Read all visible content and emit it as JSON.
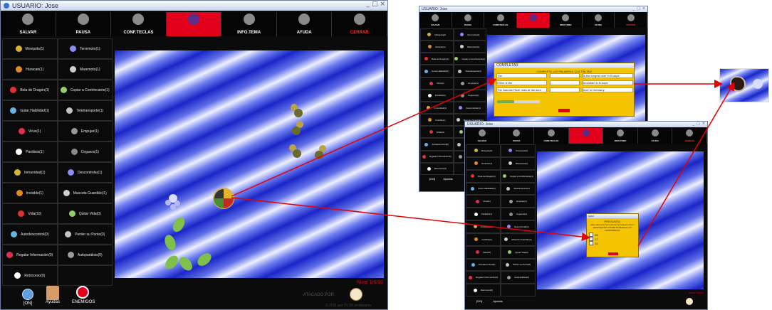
{
  "main_window": {
    "title": "USUARIO: Jose",
    "win_controls": [
      "_",
      "□",
      "×"
    ],
    "toolbar": [
      {
        "label": "SALVAR",
        "icon": "save-disc-icon",
        "red": false
      },
      {
        "label": "PAUSA",
        "icon": "pause-skull-icon",
        "red": false
      },
      {
        "label": "CONF.TECLAS",
        "icon": "keyboard-icon",
        "red": false
      },
      {
        "label": "",
        "icon": "magic-orb-icon",
        "red": true
      },
      {
        "label": "INFO.TEMA",
        "icon": "info-book-icon",
        "red": false
      },
      {
        "label": "AYUDA",
        "icon": "help-gear-icon",
        "red": false
      },
      {
        "label": "CERRAR",
        "icon": "close-door-icon",
        "red": false
      }
    ],
    "powers": [
      "Mosquita(1)",
      "Terremoto(1)",
      "Huracan(1)",
      "Maremoto(1)",
      "Bola de Dragón(1)",
      "Copiar a Contrincante(1)",
      "Gutar Habilidad(1)",
      "Teletransporte(1)",
      "Virus(1)",
      "Empujar(1)",
      "Parálisis(1)",
      "Ceguera(1)",
      "Inmunidad(1)",
      "Descontrolar(1)",
      "Invisible(1)",
      "Mascota Guardián(1)",
      "Vida(10)",
      "Quitar Vida(0)",
      "Autodescontrol(0)",
      "Perder su Punto(0)",
      "Regalar Información(0)",
      "Autoparálisis(0)",
      "Retroceso(0)",
      ""
    ],
    "bottom_items": [
      "[ON]",
      "Ayudas",
      "ENEMIGOS"
    ],
    "status_red": "Nivel 1/6/10",
    "attacked_by": "ATACADO POR:",
    "copyright": "© 2011 por 21.3D production"
  },
  "dialog_fill": {
    "title": "COMPLETAR",
    "heading": "COMPLETA LAS PALABRAS QUE FALTAN",
    "left_items": [
      "The",
      "Rhine is the",
      "The Danube River rises at the sum"
    ],
    "right_items": [
      "is the longest river in Europe",
      "mountain in Europe",
      "river in Germany"
    ]
  },
  "dialog_quiz": {
    "title": "Quiz",
    "heading": "PREGUNTA:",
    "question": "How many countries are the European Union?",
    "subheading": "RESPUESTAS POSIBLES(MARCA LAS VERDADERAS):",
    "options": [
      "28",
      "27",
      "26"
    ]
  },
  "colors": {
    "accent_red": "#e3001b",
    "arrow_red": "#e60000",
    "dialog_yellow": "#f4c400",
    "board_blue": "#1a26c8"
  }
}
